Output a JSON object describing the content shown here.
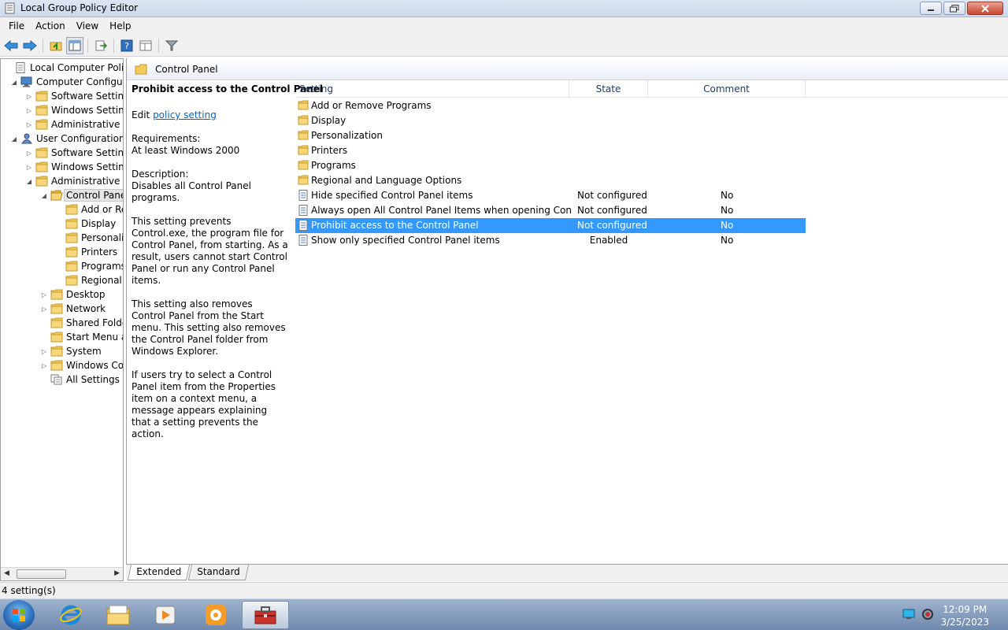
{
  "window": {
    "title": "Local Group Policy Editor"
  },
  "menu": [
    "File",
    "Action",
    "View",
    "Help"
  ],
  "tree": {
    "items": [
      {
        "label": "Local Computer Policy",
        "indent": 0,
        "exp": "",
        "icon": "policy"
      },
      {
        "label": "Computer Configura",
        "indent": 1,
        "exp": "open",
        "icon": "computer"
      },
      {
        "label": "Software Settings",
        "indent": 2,
        "exp": "closed",
        "icon": "folder"
      },
      {
        "label": "Windows Setting",
        "indent": 2,
        "exp": "closed",
        "icon": "folder"
      },
      {
        "label": "Administrative Te",
        "indent": 2,
        "exp": "closed",
        "icon": "folder"
      },
      {
        "label": "User Configuration",
        "indent": 1,
        "exp": "open",
        "icon": "user"
      },
      {
        "label": "Software Settings",
        "indent": 2,
        "exp": "closed",
        "icon": "folder"
      },
      {
        "label": "Windows Setting",
        "indent": 2,
        "exp": "closed",
        "icon": "folder"
      },
      {
        "label": "Administrative Te",
        "indent": 2,
        "exp": "open",
        "icon": "folder"
      },
      {
        "label": "Control Panel",
        "indent": 3,
        "exp": "open",
        "icon": "folder-open",
        "selected": true
      },
      {
        "label": "Add or Re",
        "indent": 4,
        "exp": "",
        "icon": "folder"
      },
      {
        "label": "Display",
        "indent": 4,
        "exp": "",
        "icon": "folder"
      },
      {
        "label": "Personaliz",
        "indent": 4,
        "exp": "",
        "icon": "folder"
      },
      {
        "label": "Printers",
        "indent": 4,
        "exp": "",
        "icon": "folder"
      },
      {
        "label": "Programs",
        "indent": 4,
        "exp": "",
        "icon": "folder"
      },
      {
        "label": "Regional a",
        "indent": 4,
        "exp": "",
        "icon": "folder"
      },
      {
        "label": "Desktop",
        "indent": 3,
        "exp": "closed",
        "icon": "folder"
      },
      {
        "label": "Network",
        "indent": 3,
        "exp": "closed",
        "icon": "folder"
      },
      {
        "label": "Shared Folder",
        "indent": 3,
        "exp": "",
        "icon": "folder"
      },
      {
        "label": "Start Menu ar",
        "indent": 3,
        "exp": "",
        "icon": "folder"
      },
      {
        "label": "System",
        "indent": 3,
        "exp": "closed",
        "icon": "folder"
      },
      {
        "label": "Windows Cor",
        "indent": 3,
        "exp": "closed",
        "icon": "folder"
      },
      {
        "label": "All Settings",
        "indent": 3,
        "exp": "",
        "icon": "all-settings"
      }
    ]
  },
  "header": {
    "path_label": "Control Panel"
  },
  "description": {
    "title": "Prohibit access to the Control Panel",
    "edit_prefix": "Edit ",
    "edit_link": "policy setting ",
    "requirements_label": "Requirements:",
    "requirements_value": "At least Windows 2000",
    "description_label": "Description:",
    "description_value": "Disables all Control Panel programs.",
    "para1": "This setting prevents Control.exe, the program file for Control Panel, from starting. As a result, users cannot start Control Panel or run any Control Panel items.",
    "para2": "This setting also removes Control Panel from the Start menu. This setting also removes the Control Panel folder from Windows Explorer.",
    "para3": "If users try to select a Control Panel item from the Properties item on a context menu, a message appears explaining that a setting prevents the action."
  },
  "list": {
    "columns": {
      "setting": "Setting",
      "state": "State",
      "comment": "Comment"
    },
    "rows": [
      {
        "type": "folder",
        "name": "Add or Remove Programs",
        "state": "",
        "comment": ""
      },
      {
        "type": "folder",
        "name": "Display",
        "state": "",
        "comment": ""
      },
      {
        "type": "folder",
        "name": "Personalization",
        "state": "",
        "comment": ""
      },
      {
        "type": "folder",
        "name": "Printers",
        "state": "",
        "comment": ""
      },
      {
        "type": "folder",
        "name": "Programs",
        "state": "",
        "comment": ""
      },
      {
        "type": "folder",
        "name": "Regional and Language Options",
        "state": "",
        "comment": ""
      },
      {
        "type": "setting",
        "name": "Hide specified Control Panel items",
        "state": "Not configured",
        "comment": "No"
      },
      {
        "type": "setting",
        "name": "Always open All Control Panel Items when opening Control ...",
        "state": "Not configured",
        "comment": "No"
      },
      {
        "type": "setting",
        "name": "Prohibit access to the Control Panel",
        "state": "Not configured",
        "comment": "No",
        "selected": true
      },
      {
        "type": "setting",
        "name": "Show only specified Control Panel items",
        "state": "Enabled",
        "comment": "No"
      }
    ]
  },
  "tabs": [
    "Extended",
    "Standard"
  ],
  "status": {
    "text": "4 setting(s)"
  },
  "taskbar": {
    "time": "12:09 PM",
    "date": "3/25/2023"
  },
  "colors": {
    "selection": "#3399ff",
    "link": "#0066cc",
    "folder": "#f3c95b"
  }
}
